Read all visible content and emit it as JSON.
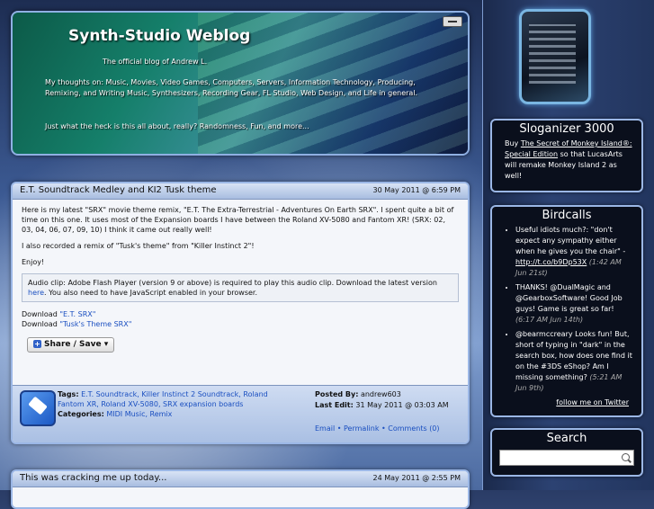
{
  "header": {
    "title": "Synth-Studio Weblog",
    "subtitle": "The official blog of Andrew L.",
    "thoughts": "My thoughts on: Music, Movies, Video Games, Computers, Servers, Information Technology, Producing, Remixing, and Writing Music, Synthesizers, Recording Gear, FL Studio, Web Design, and Life in general.",
    "what": "Just what the heck is this all about, really? Randomness, Fun, and more..."
  },
  "post1": {
    "title": "E.T. Soundtrack Medley and KI2 Tusk theme",
    "date": "30 May 2011 @ 6:59 PM",
    "p1": "Here is my latest \"SRX\" movie theme remix, \"E.T. The Extra-Terrestrial - Adventures On Earth SRX\". I spent quite a bit of time on this one. It uses most of the Expansion boards I have between the Roland XV-5080 and Fantom XR! (SRX: 02, 03, 04, 06, 07, 09, 10) I think it came out really well!",
    "p2": "I also recorded a remix of \"Tusk's theme\" from \"Killer Instinct 2\"!",
    "p3": "Enjoy!",
    "audio_text": "Audio clip: Adobe Flash Player (version 9 or above) is required to play this audio clip. Download the latest version",
    "audio_link": "here",
    "audio_tail": ". You also need to have JavaScript enabled in your browser.",
    "download_label": "Download",
    "download1": "\"E.T. SRX\"",
    "download2": "\"Tusk's Theme SRX\"",
    "share_label": "Share / Save",
    "tags_label": "Tags:",
    "tags": "E.T. Soundtrack, Killer Instinct 2 Soundtrack, Roland Fantom XR, Roland XV-5080, SRX expansion boards",
    "categories_label": "Categories:",
    "categories": "MIDI Music, Remix",
    "posted_by_label": "Posted By:",
    "posted_by": "andrew603",
    "last_edit_label": "Last Edit:",
    "last_edit": "31 May 2011 @ 03:03 AM",
    "email": "Email",
    "permalink": "Permalink",
    "comments": "Comments (0)"
  },
  "post2": {
    "title": "This was cracking me up today...",
    "date": "24 May 2011 @ 2:55 PM"
  },
  "sloganizer": {
    "title": "Sloganizer 3000",
    "pre": "Buy",
    "link": "The Secret of Monkey Island®: Special Edition",
    "post": "so that LucasArts will remake Monkey Island 2 as well!"
  },
  "birdcalls": {
    "title": "Birdcalls",
    "tweets": [
      {
        "text": "Useful idiots much?: \"don't expect any sympathy either when he gives you the chair\" -",
        "link": "http://t.co/b9Dp53X",
        "time": "(1:42 AM Jun 21st)"
      },
      {
        "text": "THANKS! @DualMagic and @GearboxSoftware! Good Job guys! Game is great so far!",
        "link": "",
        "time": "(6:17 AM Jun 14th)"
      },
      {
        "text": "@bearmccreary Looks fun! But, short of typing in \"dark\" in the search box, how does one find it on the #3DS eShop? Am I missing something?",
        "link": "",
        "time": "(5:21 AM Jun 9th)"
      }
    ],
    "follow": "follow me on Twitter"
  },
  "search": {
    "title": "Search"
  }
}
